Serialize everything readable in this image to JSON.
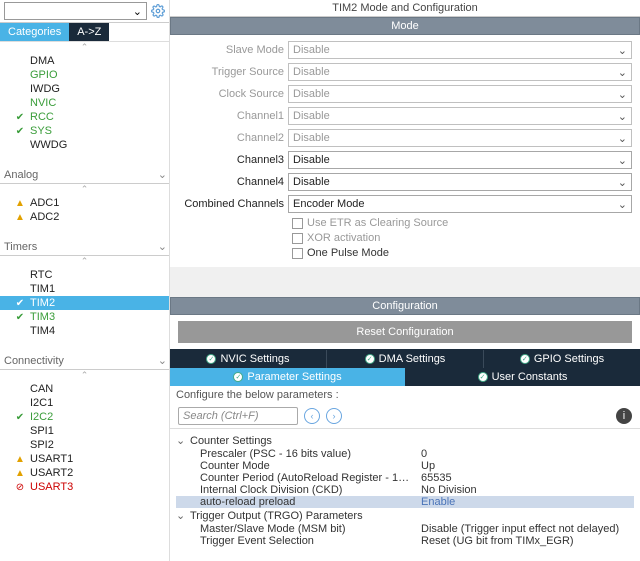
{
  "leftPanel": {
    "dropdownValue": "",
    "tabs": {
      "categories": "Categories",
      "az": "A->Z"
    },
    "groups": [
      {
        "name": "",
        "items": [
          {
            "label": "DMA",
            "style": ""
          },
          {
            "label": "GPIO",
            "style": "green"
          },
          {
            "label": "IWDG",
            "style": ""
          },
          {
            "label": "NVIC",
            "style": "green"
          },
          {
            "label": "RCC",
            "style": "green",
            "icon": "check"
          },
          {
            "label": "SYS",
            "style": "green",
            "icon": "check"
          },
          {
            "label": "WWDG",
            "style": ""
          }
        ]
      },
      {
        "name": "Analog",
        "items": [
          {
            "label": "ADC1",
            "style": "yellow",
            "icon": "warn"
          },
          {
            "label": "ADC2",
            "style": "yellow",
            "icon": "warn"
          }
        ]
      },
      {
        "name": "Timers",
        "items": [
          {
            "label": "RTC",
            "style": ""
          },
          {
            "label": "TIM1",
            "style": ""
          },
          {
            "label": "TIM2",
            "style": "selA",
            "icon": "check"
          },
          {
            "label": "TIM3",
            "style": "green",
            "icon": "check"
          },
          {
            "label": "TIM4",
            "style": ""
          }
        ]
      },
      {
        "name": "Connectivity",
        "items": [
          {
            "label": "CAN",
            "style": ""
          },
          {
            "label": "I2C1",
            "style": ""
          },
          {
            "label": "I2C2",
            "style": "green",
            "icon": "check"
          },
          {
            "label": "SPI1",
            "style": ""
          },
          {
            "label": "SPI2",
            "style": ""
          },
          {
            "label": "USART1",
            "style": "yellow",
            "icon": "warn"
          },
          {
            "label": "USART2",
            "style": "yellow",
            "icon": "warn"
          },
          {
            "label": "USART3",
            "style": "red",
            "icon": "ban"
          }
        ]
      }
    ]
  },
  "rightPanel": {
    "title": "TIM2 Mode and Configuration",
    "modeHeader": "Mode",
    "rows": [
      {
        "label": "Slave Mode",
        "value": "Disable",
        "disabled": true
      },
      {
        "label": "Trigger Source",
        "value": "Disable",
        "disabled": true
      },
      {
        "label": "Clock Source",
        "value": "Disable",
        "disabled": true
      },
      {
        "label": "Channel1",
        "value": "Disable",
        "disabled": true
      },
      {
        "label": "Channel2",
        "value": "Disable",
        "disabled": true
      },
      {
        "label": "Channel3",
        "value": "Disable",
        "disabled": false
      },
      {
        "label": "Channel4",
        "value": "Disable",
        "disabled": false
      },
      {
        "label": "Combined Channels",
        "value": "Encoder Mode",
        "disabled": false
      }
    ],
    "checks": [
      {
        "label": "Use ETR as Clearing Source",
        "disabled": true
      },
      {
        "label": "XOR activation",
        "disabled": true
      },
      {
        "label": "One Pulse Mode",
        "disabled": false
      }
    ],
    "cfgHeader": "Configuration",
    "resetBtn": "Reset Configuration",
    "tabs1": [
      "NVIC Settings",
      "DMA Settings",
      "GPIO Settings"
    ],
    "tabs2": [
      {
        "label": "Parameter Settings",
        "active": true
      },
      {
        "label": "User Constants",
        "active": false
      }
    ],
    "cfgNote": "Configure the below parameters :",
    "searchPlaceholder": "Search (Ctrl+F)",
    "params": [
      {
        "type": "node",
        "label": "Counter Settings"
      },
      {
        "type": "row",
        "k": "Prescaler (PSC - 16 bits value)",
        "v": "0"
      },
      {
        "type": "row",
        "k": "Counter Mode",
        "v": "Up"
      },
      {
        "type": "row",
        "k": "Counter Period (AutoReload Register - 1…",
        "v": "65535"
      },
      {
        "type": "row",
        "k": "Internal Clock Division (CKD)",
        "v": "No Division"
      },
      {
        "type": "row",
        "k": "auto-reload preload",
        "v": "Enable",
        "sel": true
      },
      {
        "type": "node",
        "label": "Trigger Output (TRGO) Parameters"
      },
      {
        "type": "row",
        "k": "Master/Slave Mode (MSM bit)",
        "v": "Disable (Trigger input effect not delayed)"
      },
      {
        "type": "row",
        "k": "Trigger Event Selection",
        "v": "Reset (UG bit from TIMx_EGR)"
      }
    ]
  }
}
